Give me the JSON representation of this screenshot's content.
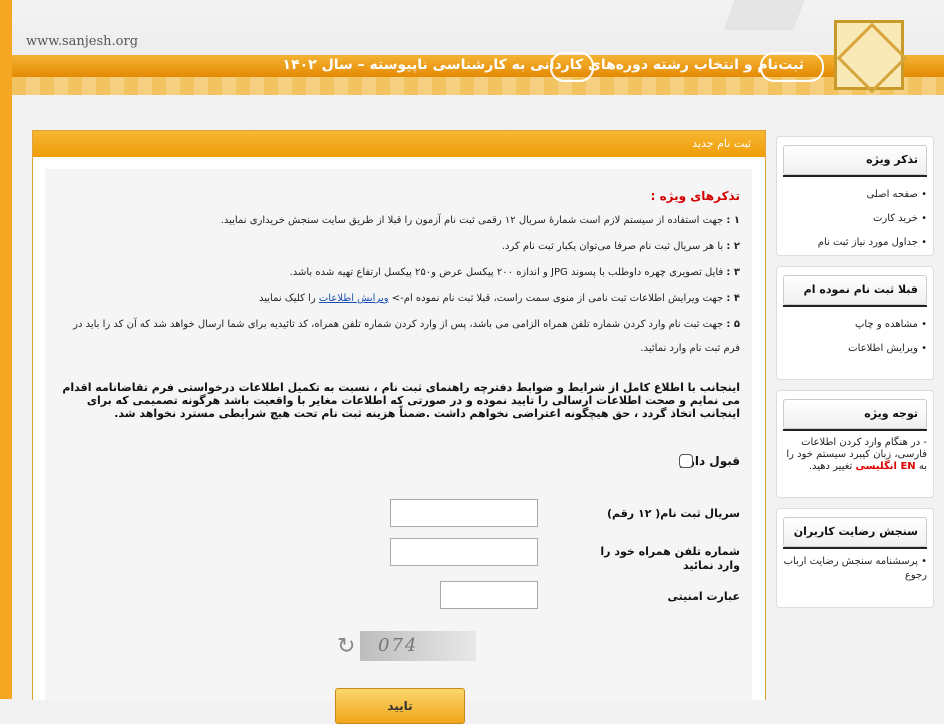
{
  "header": {
    "site": "www.sanjesh.org",
    "title": "ثبت‌نام و انتخاب رشته دوره‌های کاردانی به کارشناسی ناپیوسته – سال ۱۴۰۲"
  },
  "main": {
    "header_title": "ثبت نام جدید",
    "notes_title": "تذکرهای ویژه :",
    "notes": [
      {
        "num": "۱ :",
        "text": "جهت استفاده از سیستم لازم است شمارهٔ سریال ۱۲ رقمی ثبت نام آزمون را قبلا از طریق سایت سنجش خریداری نمایید."
      },
      {
        "num": "۲ :",
        "text": "با هر سریال ثبت نام صرفا می‌توان یکبار ثبت نام کرد."
      },
      {
        "num": "۳ :",
        "text": "فایل تصویری چهره داوطلب با پسوند JPG و اندازه ۲۰۰ پیکسل عرض و۲۵۰ پیکسل ارتفاع تهیه شده باشد."
      },
      {
        "num": "۴ :",
        "text": "جهت ویرایش اطلاعات ثبت نامی از منوی سمت راست، قبلا ثبت نام نموده ام->",
        "link": "ویرایش اطلاعات",
        "tail": "را کلیک نمایید"
      },
      {
        "num": "۵ :",
        "text": "جهت ثبت نام وارد کردن شماره تلفن همراه الزامی می باشد، پس از وارد کردن شماره تلفن همراه، کد تائیدیه برای شما ارسال خواهد شد که آن کد را باید در فرم ثبت نام وارد نمائید."
      }
    ],
    "agreement": "اینجانب با اطلاع کامل از شرایط و ضوابط دفترچه راهنمای ثبت نام ، نسبت به تکمیل اطلاعات درخواستی فرم تقاضانامه اقدام می نمایم و صحت اطلاعات ارسالی را تایید نموده و در صورتی که اطلاعات مغایر با واقعیت باشد هرگونه تصمیمی که برای اینجانب اتخاذ گردد ، حق هیچگونه اعتراضی نخواهم داشت .ضمناً هزینه ثبت نام تحت هیچ شرایطی مسترد نخواهد شد.",
    "accept_label": "قبول دارم",
    "serial_label": "سریال ثبت نام( ۱۲ رقم)",
    "phone_label": "شماره تلفن همراه خود را وارد نمائید",
    "security_label": "عبارت امنیتی",
    "captcha_text": "074",
    "confirm_label": "تایید"
  },
  "sidebar": {
    "box1": {
      "title": "تذکر ویژه",
      "items": [
        "صفحه اصلی",
        "خرید کارت",
        "جداول مورد نیاز ثبت نام"
      ]
    },
    "box2": {
      "title": "قبلا ثبت نام نموده ام",
      "items": [
        "مشاهده و چاپ",
        "ویرایش اطلاعات"
      ]
    },
    "box3": {
      "title": "توجه ویژه",
      "text1": "- در هنگام وارد کردن اطلاعات فارسی، زبان کیبرد سیستم خود را به",
      "highlight": "EN انگلیسی",
      "text2": "تغییر دهید."
    },
    "box4": {
      "title": "سنجش رضایت کاربران",
      "items": [
        "پرسشنامه سنجش رضایت ارباب رجوع"
      ]
    }
  },
  "colors": {
    "accent": "#f0a21a",
    "red": "#e00000",
    "link": "#1a4fb4"
  }
}
